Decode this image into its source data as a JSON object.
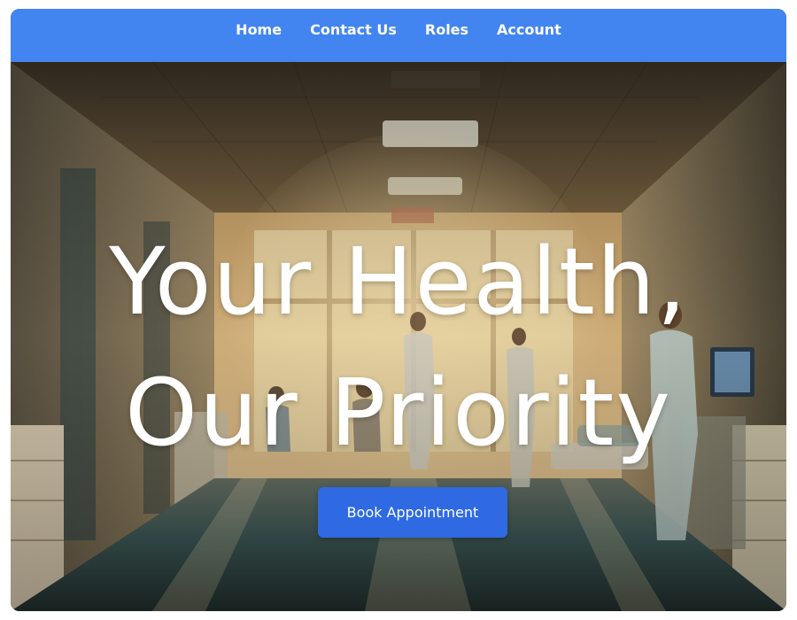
{
  "nav": {
    "items": [
      {
        "label": "Home"
      },
      {
        "label": "Contact Us"
      },
      {
        "label": "Roles"
      },
      {
        "label": "Account"
      }
    ]
  },
  "hero": {
    "title_line1": "Your Health,",
    "title_line2": "Our Priority",
    "cta_label": "Book Appointment",
    "background": "hospital-corridor-image"
  },
  "colors": {
    "nav_bg": "#4285f0",
    "cta_bg": "#2f6ae3",
    "text": "#ffffff"
  }
}
